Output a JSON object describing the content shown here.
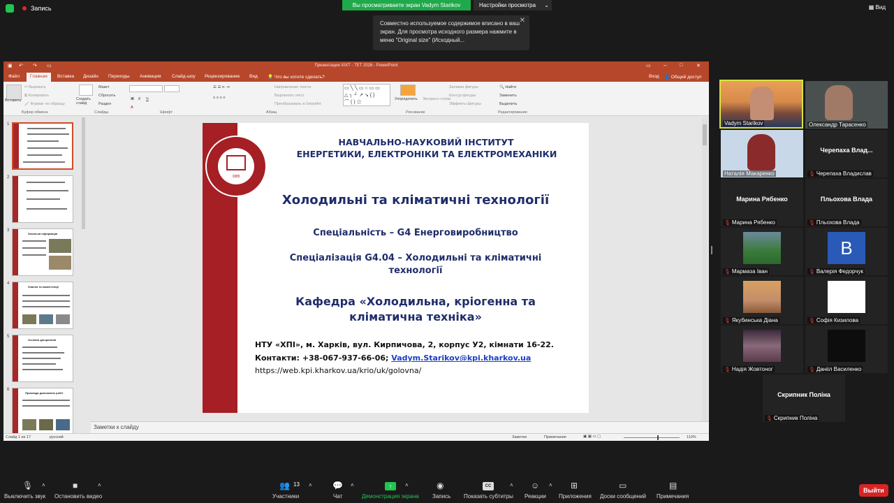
{
  "topbar": {
    "recording_label": "Запись",
    "share_banner": "Вы просматриваете экран Vadym Starikov",
    "view_settings": "Настройки просмотра",
    "view_button": "Вид"
  },
  "tooltip": {
    "text": "Совместно используемое содержимое вписано в ваш экран. Для просмотра исходного размера нажмите в меню \"Original size\" (Исходный..."
  },
  "ppt": {
    "window_title": "Презентация ХІХТ - ТЕТ 2026 - PowerPoint",
    "tabs": [
      "Файл",
      "Главная",
      "Вставка",
      "Дизайн",
      "Переходы",
      "Анимация",
      "Слайд-шоу",
      "Рецензирование",
      "Вид"
    ],
    "tell_me": "Что вы хотите сделать?",
    "login": "Вход",
    "share": "Общий доступ",
    "ribbon_groups": [
      "Буфер обмена",
      "Слайды",
      "Шрифт",
      "Абзац",
      "Рисование",
      "Редактирование"
    ],
    "ribbon_items": {
      "paste": "Вставить",
      "cut": "Вырезать",
      "copy": "Копировать",
      "format_painter": "Формат по образцу",
      "new_slide": "Создать слайд",
      "layout": "Макет",
      "reset": "Сбросить",
      "section": "Раздел",
      "text_direction": "Направление текста",
      "align_text": "Выровнять текст",
      "smartart": "Преобразовать в SmartArt",
      "arrange": "Упорядочить",
      "quick_styles": "Экспресс-стили",
      "shape_fill": "Заливка фигуры",
      "shape_outline": "Контур фигуры",
      "shape_effects": "Эффекты фигуры",
      "find": "Найти",
      "replace": "Заменить",
      "select": "Выделить"
    },
    "thumb_titles": [
      "Загальна інформація",
      "Знання та компетенції",
      "Основні дисципліни",
      "Приклади дипломних робіт"
    ],
    "notes_placeholder": "Заметки к слайду",
    "status": {
      "slide_info": "Слайд 1 из 17",
      "language": "русский",
      "notes": "Заметки",
      "comments": "Примечания",
      "zoom": "110%"
    }
  },
  "slide": {
    "header_line1": "НАВЧАЛЬНО-НАУКОВИЙ ІНСТИТУТ",
    "header_line2": "ЕНЕРГЕТИКИ, ЕЛЕКТРОНІКИ ТА ЕЛЕКТРОМЕХАНІКИ",
    "title": "Холодильні та кліматичні технології",
    "specialty": "Спеціальність – G4 Енерговиробництво",
    "specialization_line1": "Спеціалізація G4.04 – Холодильні та кліматичні",
    "specialization_line2": "технології",
    "department_line1": "Кафедра «Холодильна, кріогенна та",
    "department_line2": "кліматична техніка»",
    "address": "НТУ «ХПІ», м. Харків, вул. Кирпичова, 2, корпус У2, кімнати 16-22.",
    "contacts_prefix": "Контакти: +38-067-937-66-06;",
    "email": "Vadym.Starikov@kpi.kharkov.ua",
    "website": "https://web.kpi.kharkov.ua/krio/uk/golovna/",
    "seal_year": "1885"
  },
  "participants": [
    {
      "name": "Vadym Starikov",
      "muted": false,
      "video": true,
      "active": true
    },
    {
      "name": "Олександр Тарасенко",
      "muted": false,
      "video": true
    },
    {
      "name": "Наталія Макаренко",
      "muted": false,
      "video": true
    },
    {
      "name": "Черепаха Владислав",
      "big": "Черепаха Влад...",
      "muted": true,
      "video": false
    },
    {
      "name": "Марина Рябенко",
      "big": "Марина Рябенко",
      "muted": true,
      "video": false
    },
    {
      "name": "Пльохова Влада",
      "big": "Пльохова Влада",
      "muted": true,
      "video": false
    },
    {
      "name": "Мармаза Іван",
      "muted": true,
      "video": false
    },
    {
      "name": "Валерія Федорчук",
      "muted": true,
      "video": false,
      "avatar_letter": "B"
    },
    {
      "name": "Якубинська Діана",
      "muted": true,
      "video": false
    },
    {
      "name": "Софія Кизилова",
      "muted": true,
      "video": false
    },
    {
      "name": "Надія Жовтоног",
      "muted": true,
      "video": false
    },
    {
      "name": "Данііл Василенко",
      "muted": true,
      "video": false
    },
    {
      "name": "Скрипник Поліна",
      "big": "Скрипник Поліна",
      "muted": true,
      "video": false
    }
  ],
  "toolbar": {
    "mute": "Выключить звук",
    "video": "Остановить видео",
    "participants": "Участники",
    "participants_count": "13",
    "chat": "Чат",
    "share": "Демонстрация экрана",
    "record": "Запись",
    "captions": "Показать субтитры",
    "reactions": "Реакции",
    "apps": "Приложения",
    "whiteboards": "Доски сообщений",
    "notes": "Примечания",
    "end": "Выйти"
  },
  "colors": {
    "ppt_accent": "#b7472a",
    "slide_red": "#a51f24",
    "slide_blue": "#1f2d6b",
    "share_green": "#1fa94a",
    "end_red": "#d92424",
    "active_speaker": "#d7e33f"
  }
}
